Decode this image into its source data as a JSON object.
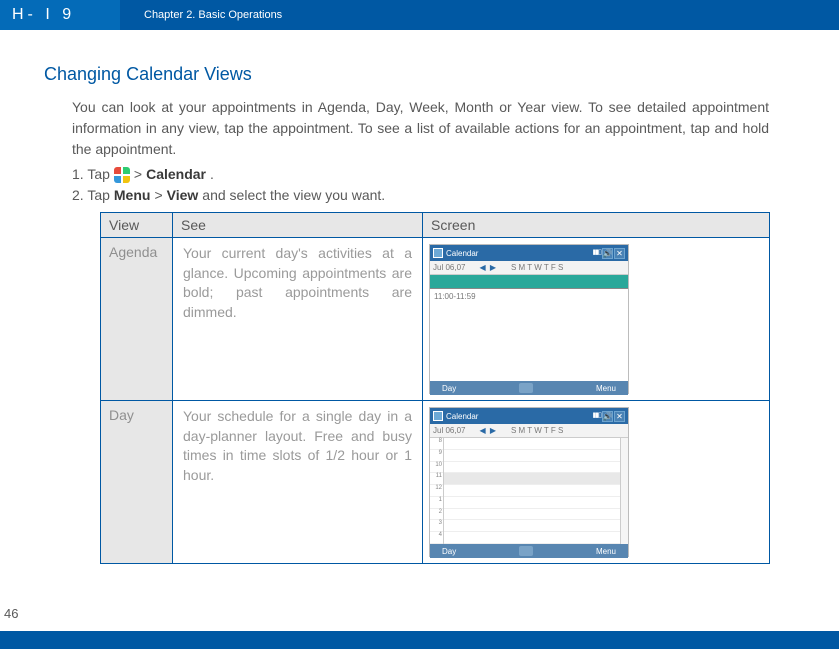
{
  "header": {
    "logo": "H- I 9",
    "chapter": "Chapter 2. Basic Operations"
  },
  "heading": "Changing Calendar Views",
  "intro": "You can look at your appointments in Agenda, Day, Week, Month or Year view. To see detailed appointment information in any view, tap the appointment. To see a list of available actions for an appointment, tap and hold the appointment.",
  "steps": {
    "s1a": "1. Tap",
    "s1b": ">",
    "s1c": "Calendar",
    "s1d": ".",
    "s2a": "2. Tap",
    "s2b": "Menu",
    "s2c": ">",
    "s2d": "View",
    "s2e": "and select the view you want."
  },
  "table": {
    "h1": "View",
    "h2": "See",
    "h3": "Screen",
    "rows": [
      {
        "view": "Agenda",
        "desc": "Your current day's activities at a glance. Upcoming appointments are bold; past appointments are dimmed."
      },
      {
        "view": "Day",
        "desc": "Your schedule for a single day in a day-planner layout. Free and busy times in time slots of 1/2 hour or 1 hour."
      }
    ]
  },
  "mock": {
    "app": "Calendar",
    "date": "Jul 06,07",
    "arrows": "◀ ▶",
    "daystrip": "S M T W T F S",
    "agenda_line": "11:00-11:59",
    "hours": [
      "8",
      "9",
      "10",
      "11",
      "12",
      "1",
      "2",
      "3",
      "4"
    ],
    "bb_left": "Day",
    "bb_right": "Menu"
  },
  "page": "46"
}
